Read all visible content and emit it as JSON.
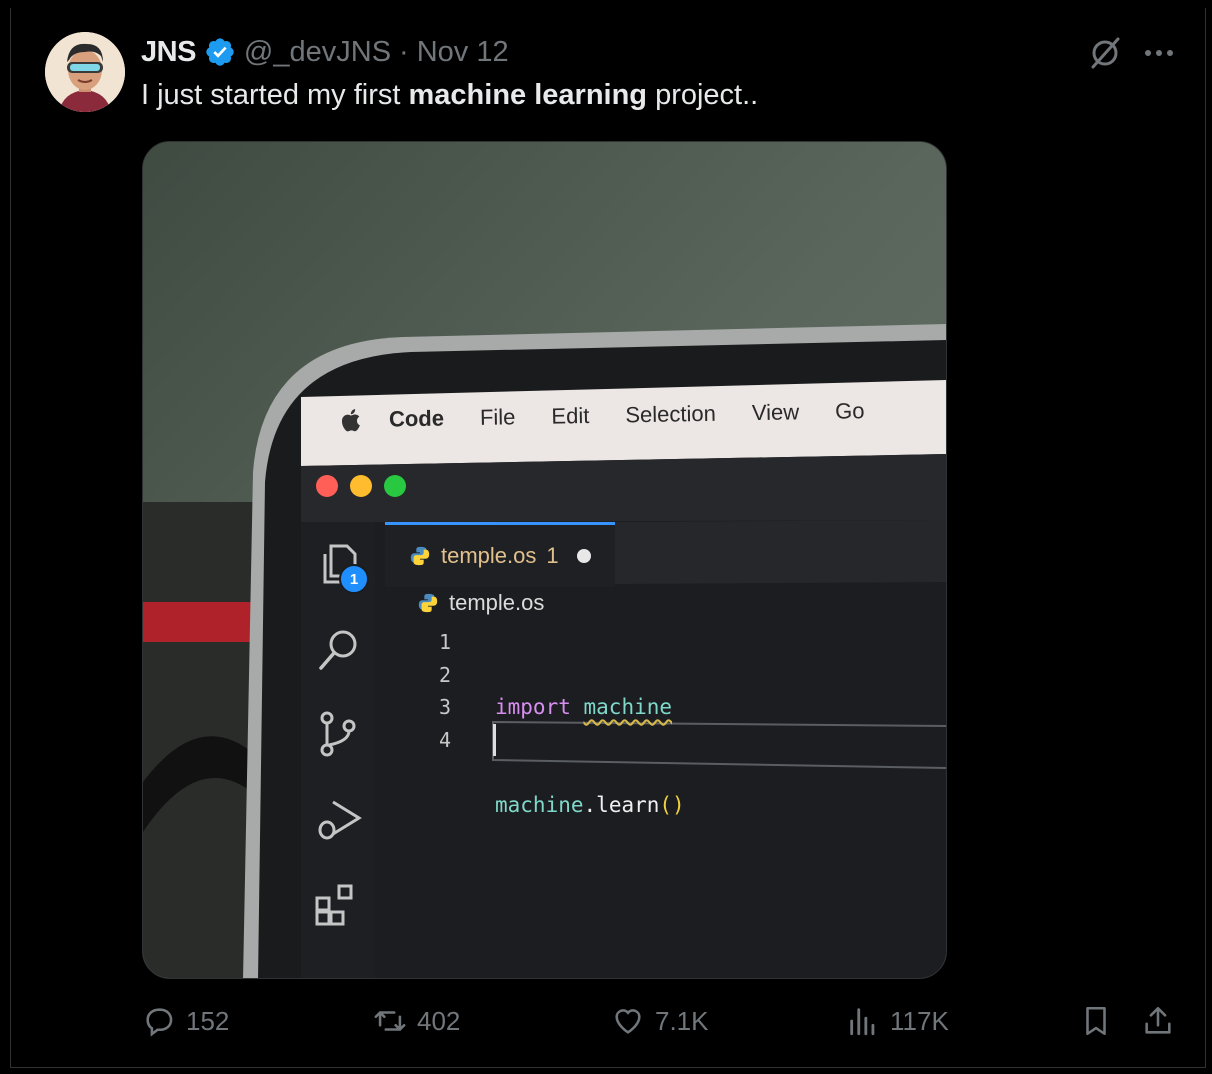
{
  "tweet": {
    "display_name": "JNS",
    "handle": "@_devJNS",
    "separator": "·",
    "date": "Nov 12",
    "text_before": "I just started my first ",
    "text_bold": "machine learning",
    "text_after": " project..",
    "verified": true,
    "accent_color": "#1d9bf0"
  },
  "media": {
    "menubar": {
      "app": "Code",
      "items": [
        "File",
        "Edit",
        "Selection",
        "View",
        "Go"
      ]
    },
    "editor": {
      "tab_label": "temple.os",
      "tab_problems": "1",
      "breadcrumb": "temple.os",
      "line_numbers": [
        "1",
        "2",
        "3",
        "4"
      ],
      "line1_keyword": "import",
      "line1_module": "machine",
      "line2_object": "machine",
      "line2_dot": ".",
      "line2_method": "learn",
      "line2_parens": "()",
      "explorer_badge": "1"
    }
  },
  "actions": {
    "replies": "152",
    "reposts": "402",
    "likes": "7.1K",
    "views": "117K"
  },
  "icons": {
    "reply": "reply-icon",
    "repost": "repost-icon",
    "like": "heart-icon",
    "views": "views-chart-icon",
    "bookmark": "bookmark-icon",
    "share": "share-icon",
    "grok": "grok-icon",
    "more": "more-icon"
  }
}
